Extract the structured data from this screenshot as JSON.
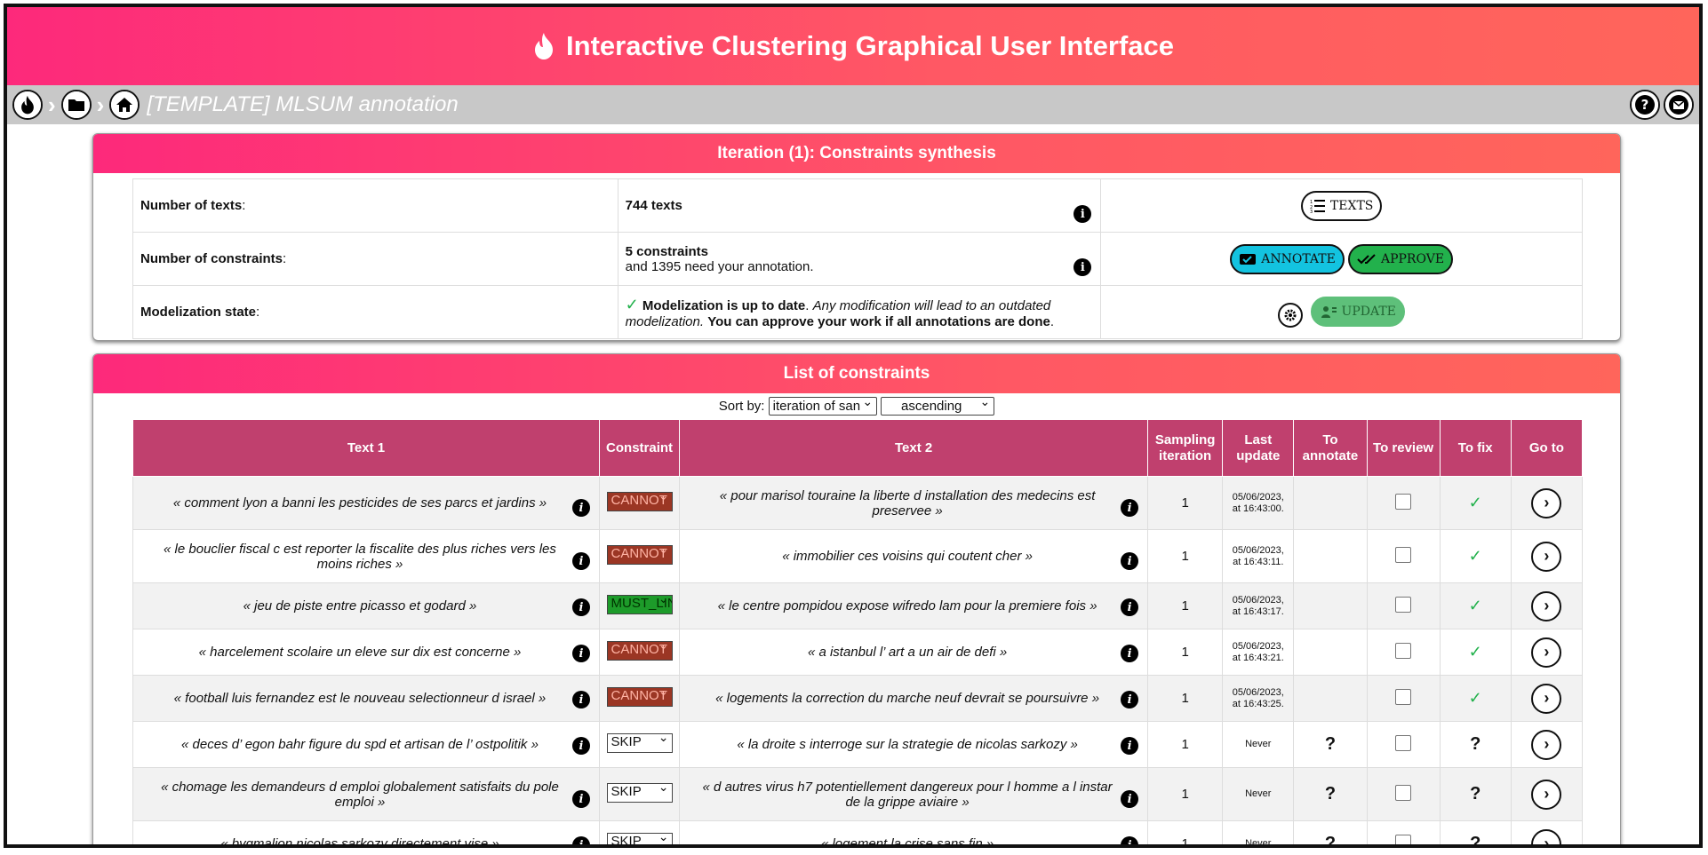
{
  "app": {
    "title": "Interactive Clustering Graphical User Interface"
  },
  "nav": {
    "project_title": "[TEMPLATE] MLSUM annotation"
  },
  "synthesis": {
    "title": "Iteration (1): Constraints synthesis",
    "rows": {
      "texts": {
        "label": "Number of texts",
        "value": "744 texts",
        "button": "TEXTS"
      },
      "constraints": {
        "label": "Number of constraints",
        "value": "5 constraints",
        "sub": "and 1395 need your annotation.",
        "annotate": "ANNOTATE",
        "approve": "APPROVE"
      },
      "state": {
        "label": "Modelization state",
        "status": "Modelization is up to date",
        "warn": "Any modification will lead to an outdated modelization.",
        "note": "You can approve your work if all annotations are done",
        "update": "UPDATE"
      }
    }
  },
  "list": {
    "title": "List of constraints",
    "sort_label": "Sort by:",
    "sort_field": "iteration of san",
    "sort_order": "ascending",
    "headers": {
      "text1": "Text 1",
      "constraint": "Constraint",
      "text2": "Text 2",
      "sampling": "Sampling iteration",
      "last_update": "Last update",
      "to_annotate": "To annotate",
      "to_review": "To review",
      "to_fix": "To fix",
      "go_to": "Go to"
    },
    "rows": [
      {
        "text1": "« comment lyon a banni les pesticides de ses parcs et jardins »",
        "constraint": "CANNOT",
        "text2": "« pour marisol touraine la liberte d installation des medecins est preservee »",
        "iteration": "1",
        "date": "05/06/2023,",
        "time": "at 16:43:00.",
        "annotate": "",
        "fix": "✓"
      },
      {
        "text1": "« le bouclier fiscal c est reporter la fiscalite des plus riches vers les moins riches »",
        "constraint": "CANNOT",
        "text2": "« immobilier ces voisins qui coutent cher »",
        "iteration": "1",
        "date": "05/06/2023,",
        "time": "at 16:43:11.",
        "annotate": "",
        "fix": "✓"
      },
      {
        "text1": "« jeu de piste entre picasso et godard »",
        "constraint": "MUST_LINK",
        "text2": "« le centre pompidou expose wifredo lam pour la premiere fois »",
        "iteration": "1",
        "date": "05/06/2023,",
        "time": "at 16:43:17.",
        "annotate": "",
        "fix": "✓"
      },
      {
        "text1": "« harcelement scolaire un eleve sur dix est concerne »",
        "constraint": "CANNOT",
        "text2": "« a istanbul l’ art a un air de defi »",
        "iteration": "1",
        "date": "05/06/2023,",
        "time": "at 16:43:21.",
        "annotate": "",
        "fix": "✓"
      },
      {
        "text1": "« football luis fernandez est le nouveau selectionneur d israel »",
        "constraint": "CANNOT",
        "text2": "« logements la correction du marche neuf devrait se poursuivre »",
        "iteration": "1",
        "date": "05/06/2023,",
        "time": "at 16:43:25.",
        "annotate": "",
        "fix": "✓"
      },
      {
        "text1": "« deces d’ egon bahr figure du spd et artisan de l’ ostpolitik »",
        "constraint": "SKIP",
        "text2": "« la droite s interroge sur la strategie de nicolas sarkozy »",
        "iteration": "1",
        "date": "Never",
        "time": "",
        "annotate": "?",
        "fix": "?"
      },
      {
        "text1": "« chomage les demandeurs d emploi globalement satisfaits du pole emploi »",
        "constraint": "SKIP",
        "text2": "« d autres virus h7 potentiellement dangereux pour l homme a l instar de la grippe aviaire »",
        "iteration": "1",
        "date": "Never",
        "time": "",
        "annotate": "?",
        "fix": "?"
      },
      {
        "text1": "« bygmalion nicolas sarkozy directement vise »",
        "constraint": "SKIP",
        "text2": "« logement la crise sans fin »",
        "iteration": "1",
        "date": "Never",
        "time": "",
        "annotate": "?",
        "fix": "?"
      }
    ]
  },
  "colors": {
    "brand_pink": "#fd297b",
    "brand_coral": "#ff655b",
    "header_row": "#c0406e",
    "cannot": "#9b3624",
    "must": "#1d9b2a"
  },
  "icons": [
    "flame-icon",
    "folder-icon",
    "home-icon",
    "help-icon",
    "mail-icon",
    "info-icon",
    "list-icon",
    "annotate-icon",
    "double-check-icon",
    "gear-icon",
    "update-icon",
    "chevron-right-icon",
    "check-icon"
  ]
}
